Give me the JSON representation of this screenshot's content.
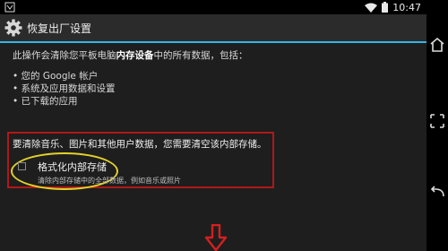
{
  "status_bar": {
    "time": "10:47"
  },
  "header": {
    "title": "恢复出厂设置"
  },
  "body": {
    "intro_prefix": "此操作会清除您平板电脑",
    "intro_bold": "内存设备",
    "intro_suffix": "中的所有数据，包括：",
    "bullets": [
      "您的 Google 帐户",
      "系统及应用数据和设置",
      "已下载的应用"
    ],
    "note": "要清除音乐、图片和其他用户数据，您需要清空该内部存储。"
  },
  "option": {
    "title": "格式化内部存储",
    "subtitle": "清除内部存储中的全部数据，例如音乐或照片",
    "checked": false
  },
  "colors": {
    "accent": "#33b5e5",
    "highlight_box": "#b01818",
    "ellipse": "#e3d12a",
    "arrow": "#d32020"
  }
}
